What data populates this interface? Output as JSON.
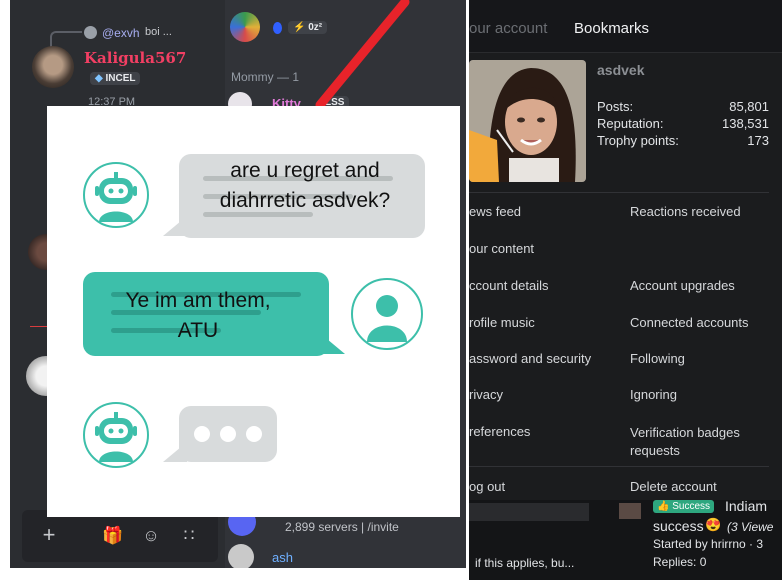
{
  "discord": {
    "reply_author": "@exvh",
    "reply_snippet": "boi ...",
    "username": "Kaligula567",
    "role_badge": "INCEL",
    "timestamp": "12:37 PM",
    "top_badge": "⚡ 0z²",
    "section_header": "Mommy — 1",
    "member_top_name": "Kitty",
    "member_top_badge": "LSS",
    "servers_text": "2,899 servers | /invite",
    "member_bottom_name": "ash",
    "user_bar_icons": [
      "plus-icon",
      "gift-icon",
      "emoji-icon",
      "apps-icon"
    ]
  },
  "forum": {
    "tabs": [
      "Your account",
      "Bookmarks"
    ],
    "tab_visible_fragment": "our account",
    "username": "asdvek",
    "stats": [
      {
        "label": "Posts:",
        "value": "85,801"
      },
      {
        "label": "Reputation:",
        "value": "138,531"
      },
      {
        "label": "Trophy points:",
        "value": "173"
      }
    ],
    "menu_left": [
      "ews feed",
      "our content",
      "ccount details",
      "rofile music",
      "assword and security",
      "rivacy",
      "references"
    ],
    "menu_right": [
      "Reactions received",
      "",
      "Account upgrades",
      "Connected accounts",
      "Following",
      "Ignoring",
      "Verification badges requests"
    ],
    "logout": "og out",
    "delete_account": "Delete account",
    "thread_badge": "Success",
    "thread_title_part": "Indiam",
    "thread_line2_word": "success",
    "thread_line2_emoji": "😍",
    "thread_line2_views": "(3 Viewe",
    "thread_started": "Started by hrirrno · 3",
    "thread_replies": "Replies: 0",
    "bottom_snippet": "if this applies, bu..."
  },
  "chat": {
    "message_1": "are u regret and diahrretic asdvek?",
    "message_2": "Ye im am them, ATU",
    "colors": {
      "teal": "#3dbfaa",
      "grey": "#d8dbdc"
    }
  }
}
